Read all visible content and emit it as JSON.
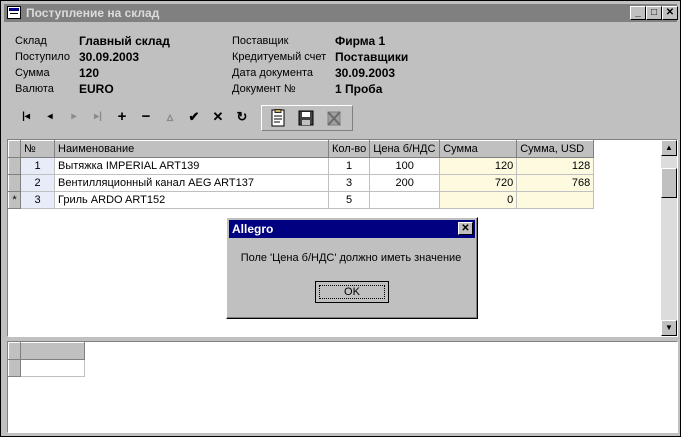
{
  "window": {
    "title": "Поступление на склад",
    "buttons": {
      "minimize": "_",
      "maximize": "□",
      "close": "✕"
    }
  },
  "info": {
    "left": [
      {
        "label": "Склад",
        "value": "Главный склад"
      },
      {
        "label": "Поступило",
        "value": "30.09.2003"
      },
      {
        "label": "Сумма",
        "value": "120"
      },
      {
        "label": "Валюта",
        "value": "EURO"
      }
    ],
    "right": [
      {
        "label": "Поставщик",
        "value": "Фирма 1"
      },
      {
        "label": "Кредитуемый счет",
        "value": "Поставщики"
      },
      {
        "label": "Дата документа",
        "value": "30.09.2003"
      },
      {
        "label": "Документ №",
        "value": "1 Проба"
      }
    ]
  },
  "toolbar": {
    "first": "|◂",
    "prior": "◂",
    "next": "▸",
    "last": "▸|",
    "insert": "+",
    "delete": "−",
    "edit": "▵",
    "post": "✔",
    "cancel": "✕",
    "refresh": "↻"
  },
  "grid": {
    "headers": [
      "№",
      "Наименование",
      "Кол-во",
      "Цена б/НДС",
      "Сумма",
      "Сумма, USD"
    ],
    "rows": [
      {
        "indicator": "",
        "n": "1",
        "name": "Вытяжка IMPERIAL ART139",
        "qty": "1",
        "price": "100",
        "sum": "120",
        "usd": "128"
      },
      {
        "indicator": "",
        "n": "2",
        "name": "Вентилляционный канал AEG ART137",
        "qty": "3",
        "price": "200",
        "sum": "720",
        "usd": "768"
      },
      {
        "indicator": "*",
        "n": "3",
        "name": "Гриль ARDO ART152",
        "qty": "5",
        "price": "",
        "sum": "0",
        "usd": ""
      }
    ]
  },
  "dialog": {
    "title": "Allegro",
    "message": "Поле 'Цена б/НДС' должно иметь значение",
    "ok_label": "OK"
  }
}
